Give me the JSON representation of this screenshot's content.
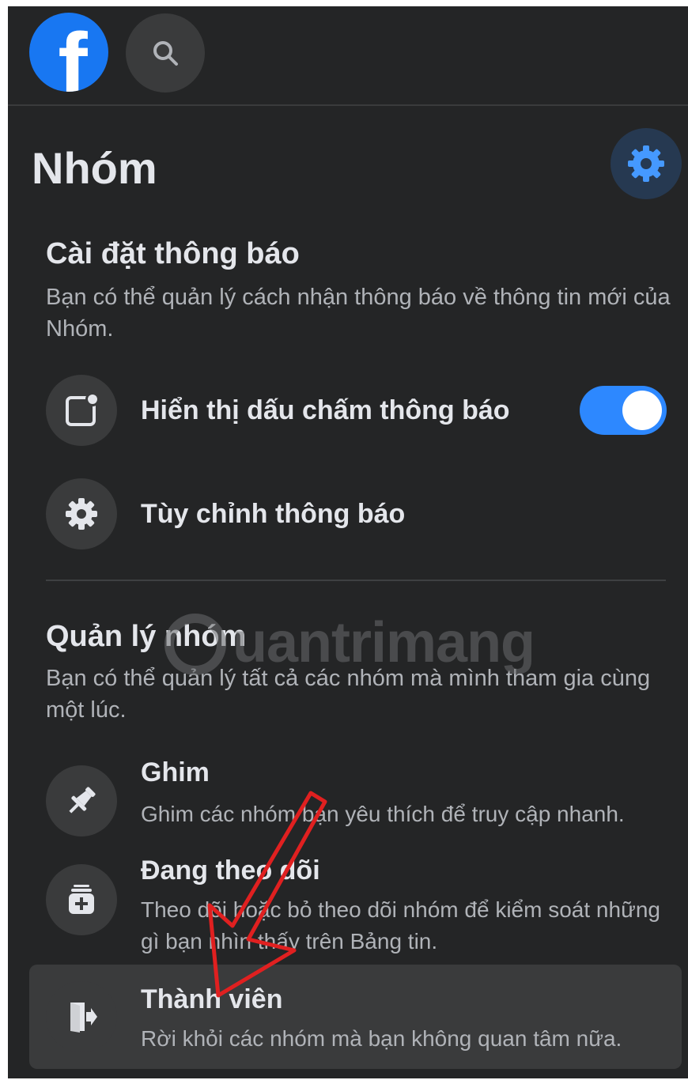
{
  "header": {
    "logo_letter": "f",
    "logo_icon": "facebook-logo",
    "search_icon": "search-icon"
  },
  "page": {
    "title": "Nhóm",
    "settings_icon": "gear-icon"
  },
  "notifications": {
    "title": "Cài đặt thông báo",
    "description": "Bạn có thể quản lý cách nhận thông báo về thông tin mới của Nhóm.",
    "items": [
      {
        "icon": "notification-dot-icon",
        "label": "Hiển thị dấu chấm thông báo",
        "toggle_on": true
      },
      {
        "icon": "gear-icon",
        "label": "Tùy chỉnh thông báo"
      }
    ]
  },
  "manage": {
    "title": "Quản lý nhóm",
    "description": "Bạn có thể quản lý tất cả các nhóm mà mình tham gia cùng một lúc.",
    "items": [
      {
        "icon": "pin-icon",
        "label": "Ghim",
        "description": "Ghim các nhóm bạn yêu thích để truy cập nhanh."
      },
      {
        "icon": "follow-icon",
        "label": "Đang theo dõi",
        "description": "Theo dõi hoặc bỏ theo dõi nhóm để kiểm soát những gì bạn nhìn thấy trên Bảng tin."
      },
      {
        "icon": "leave-icon",
        "label": "Thành viên",
        "description": "Rời khỏi các nhóm mà bạn không quan tâm nữa."
      }
    ]
  },
  "watermark": {
    "text": "uantrimang"
  },
  "colors": {
    "background": "#242526",
    "surface": "#3a3b3c",
    "primary_text": "#e4e6eb",
    "secondary_text": "#b0b3b8",
    "accent": "#2d88ff",
    "annotation_arrow": "#e02020"
  }
}
